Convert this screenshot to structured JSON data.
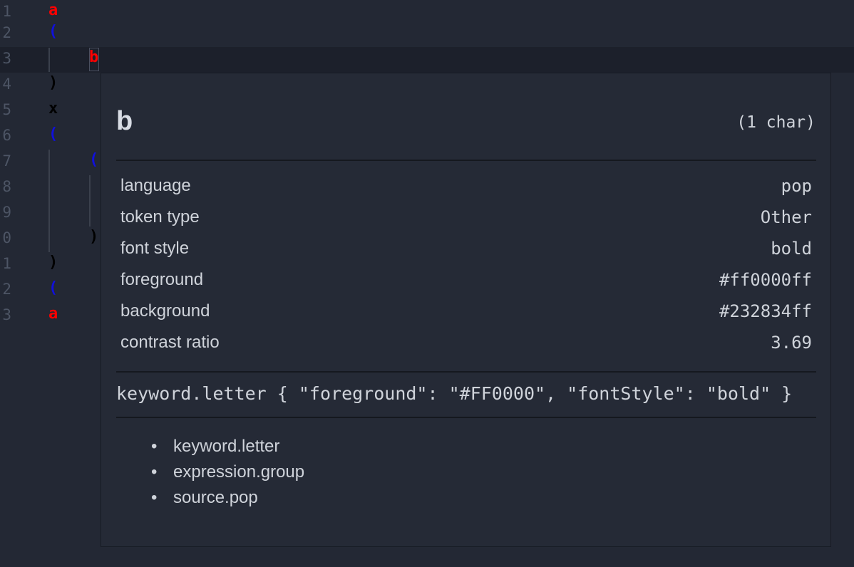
{
  "editor": {
    "lines": [
      {
        "number": "1",
        "tokens": [
          {
            "text": "a",
            "color": "#ff0000"
          }
        ]
      },
      {
        "number": "2",
        "tokens": [
          {
            "text": "(",
            "color": "#1010dd"
          }
        ]
      },
      {
        "number": "3",
        "tokens": [
          {
            "text": "b",
            "color": "#ff0000"
          }
        ],
        "current": true
      },
      {
        "number": "4",
        "tokens": [
          {
            "text": ")",
            "color": "#000000"
          }
        ]
      },
      {
        "number": "5",
        "tokens": [
          {
            "text": "x",
            "color": "#000000"
          }
        ]
      },
      {
        "number": "6",
        "tokens": [
          {
            "text": "(",
            "color": "#1010dd"
          }
        ]
      },
      {
        "number": "7",
        "tokens": [
          {
            "text": "(",
            "color": "#1010dd"
          }
        ]
      },
      {
        "number": "8",
        "tokens": []
      },
      {
        "number": "9",
        "tokens": []
      },
      {
        "number": "0",
        "tokens": [
          {
            "text": ")",
            "color": "#000000"
          }
        ]
      },
      {
        "number": "1",
        "tokens": [
          {
            "text": ")",
            "color": "#000000"
          }
        ]
      },
      {
        "number": "2",
        "tokens": [
          {
            "text": "(",
            "color": "#1010dd"
          }
        ]
      },
      {
        "number": "3",
        "tokens": [
          {
            "text": "a",
            "color": "#ff0000"
          }
        ]
      }
    ]
  },
  "hover": {
    "title": "b",
    "length": "(1 char)",
    "properties": [
      {
        "label": "language",
        "value": "pop"
      },
      {
        "label": "token type",
        "value": "Other"
      },
      {
        "label": "font style",
        "value": "bold"
      },
      {
        "label": "foreground",
        "value": "#ff0000ff"
      },
      {
        "label": "background",
        "value": "#232834ff"
      },
      {
        "label": "contrast ratio",
        "value": "3.69"
      }
    ],
    "theme_rule": "keyword.letter { \"foreground\": \"#FF0000\", \"fontStyle\": \"bold\" }",
    "scopes": [
      "keyword.letter",
      "expression.group",
      "source.pop"
    ]
  },
  "colors": {
    "background": "#232834",
    "current_line": "#1c202b",
    "line_number": "#4d5565"
  }
}
